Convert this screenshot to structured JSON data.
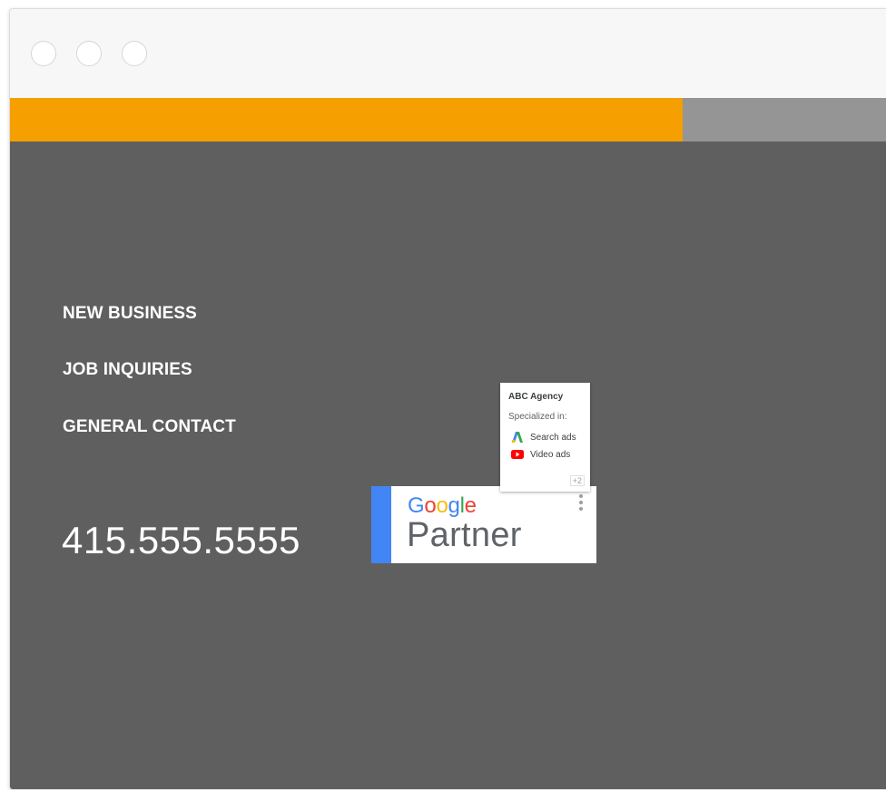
{
  "window": {
    "controls": [
      "close",
      "minimize",
      "maximize"
    ]
  },
  "colors": {
    "accent_orange": "#f59f00",
    "accent_gray": "#959595",
    "content_bg": "#5f5f5f",
    "google_blue": "#4285f4"
  },
  "contact": {
    "links": [
      "NEW BUSINESS",
      "JOB INQUIRIES",
      "GENERAL CONTACT"
    ],
    "phone": "415.555.5555"
  },
  "partner_badge": {
    "google_letters": [
      {
        "ch": "G",
        "color": "#4285f4"
      },
      {
        "ch": "o",
        "color": "#ea4335"
      },
      {
        "ch": "o",
        "color": "#fbbc05"
      },
      {
        "ch": "g",
        "color": "#4285f4"
      },
      {
        "ch": "l",
        "color": "#34a853"
      },
      {
        "ch": "e",
        "color": "#ea4335"
      }
    ],
    "partner_text": "Partner",
    "menu_icon": "more-vert-icon"
  },
  "partner_card": {
    "agency": "ABC Agency",
    "specialized_label": "Specialized in:",
    "specialties": [
      {
        "label": "Search ads",
        "icon": "google-ads-icon"
      },
      {
        "label": "Video ads",
        "icon": "youtube-icon"
      }
    ],
    "more": "+2"
  }
}
